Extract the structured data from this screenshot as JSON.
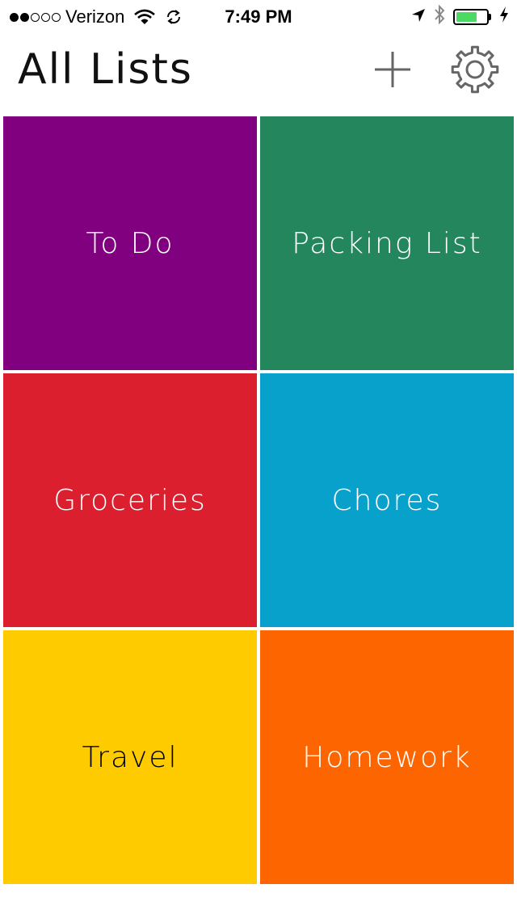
{
  "status_bar": {
    "carrier": "Verizon",
    "time": "7:49 PM",
    "signal_bars_filled": 2,
    "signal_bars_total": 5,
    "battery_fill_fraction": 0.7,
    "battery_color": "#4cd964"
  },
  "header": {
    "title": "All Lists",
    "add_icon": "plus-icon",
    "settings_icon": "gear-icon"
  },
  "lists": [
    {
      "label": "To Do",
      "color": "#800080",
      "text_color": "#ffffff"
    },
    {
      "label": "Packing List",
      "color": "#23865c",
      "text_color": "#ffffff"
    },
    {
      "label": "Groceries",
      "color": "#dc1f2e",
      "text_color": "#ffffff"
    },
    {
      "label": "Chores",
      "color": "#07a1cb",
      "text_color": "#ffffff"
    },
    {
      "label": "Travel",
      "color": "#fdcb00",
      "text_color": "#000000"
    },
    {
      "label": "Homework",
      "color": "#fd6500",
      "text_color": "#ffffff"
    }
  ]
}
